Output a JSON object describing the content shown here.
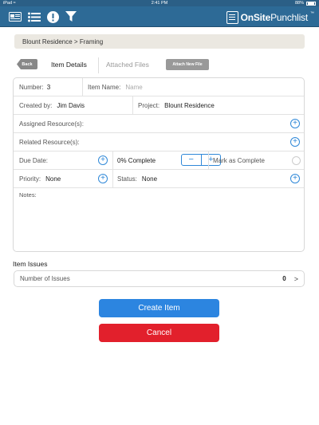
{
  "status_bar": {
    "device": "iPad",
    "signal": "≈",
    "time": "2:41 PM",
    "battery": "88%"
  },
  "app": {
    "brand_bold": "OnSite",
    "brand_light": "Punchlist",
    "brand_tm": "™"
  },
  "breadcrumb": "Blount Residence > Framing",
  "nav": {
    "back_label": "Back",
    "tabs": [
      "Item Details",
      "Attached Files"
    ],
    "attach_label": "Attach New File"
  },
  "form": {
    "number_label": "Number:",
    "number_value": "3",
    "item_name_label": "Item Name:",
    "item_name_placeholder": "Name",
    "created_by_label": "Created by:",
    "created_by_value": "Jim Davis",
    "project_label": "Project:",
    "project_value": "Blount Residence",
    "assigned_label": "Assigned Resource(s):",
    "related_label": "Related Resource(s):",
    "due_date_label": "Due Date:",
    "percent_complete": "0% Complete",
    "minus": "−",
    "plus": "+",
    "mark_complete_label": "Mark as Complete",
    "priority_label": "Priority:",
    "priority_value": "None",
    "status_label": "Status:",
    "status_value": "None",
    "notes_label": "Notes:",
    "add_symbol": "+"
  },
  "issues": {
    "title": "Item Issues",
    "row_label": "Number of Issues",
    "count": "0",
    "chevron": ">"
  },
  "actions": {
    "create_label": "Create Item",
    "cancel_label": "Cancel"
  },
  "colors": {
    "toolbar": "#2d6a96",
    "accent": "#2f88d8",
    "create": "#2c85e0",
    "cancel": "#e2202c"
  }
}
